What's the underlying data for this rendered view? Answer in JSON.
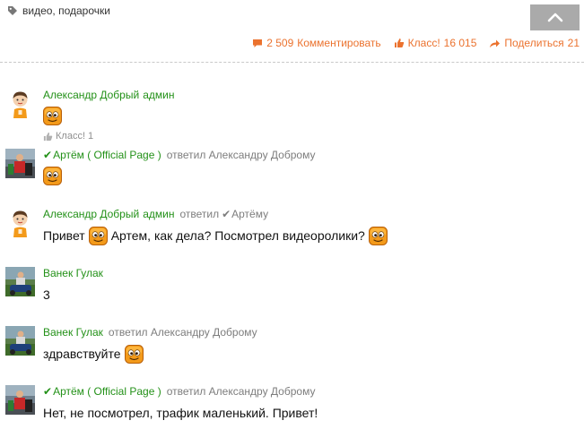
{
  "tags": {
    "text": "видео, подарочки"
  },
  "actions": {
    "comment_count": "2 509",
    "comment_label": "Комментировать",
    "like_label": "Класс!",
    "like_count": "16 015",
    "share_label": "Поделиться",
    "share_count": "21"
  },
  "colors": {
    "accent": "#eb722e",
    "author": "#239118",
    "muted": "#7d7d7d",
    "scroll_btn": "#aaaaaa"
  },
  "comments": [
    {
      "author": "Александр Добрый",
      "author_suffix": "админ",
      "verified": false,
      "reply_to": "",
      "reply_verified": false,
      "text": "",
      "smile_end": true,
      "likes": "Класс! 1",
      "avatar": "boy-cartoon"
    },
    {
      "author": "Артём ( Official Page )",
      "author_suffix": "",
      "verified": true,
      "reply_to": "ответил Александру Доброму",
      "reply_verified": false,
      "text": "",
      "smile_end": true,
      "likes": "",
      "avatar": "photo-red"
    },
    {
      "author": "Александр Добрый",
      "author_suffix": "админ",
      "verified": false,
      "reply_to_prefix": "ответил",
      "reply_to": "Артёму",
      "reply_verified": true,
      "text_part1": "Привет",
      "text_part2": "Артем, как дела? Посмотрел видеоролики?",
      "smile_end": true,
      "likes": "",
      "avatar": "boy-cartoon"
    },
    {
      "author": "Ванек Гулак",
      "author_suffix": "",
      "verified": false,
      "reply_to": "",
      "reply_verified": false,
      "text": "3",
      "smile_end": false,
      "likes": "",
      "avatar": "photo-green"
    },
    {
      "author": "Ванек Гулак",
      "author_suffix": "",
      "verified": false,
      "reply_to": "ответил Александру Доброму",
      "reply_verified": false,
      "text": "здравствуйте",
      "smile_end": true,
      "likes": "",
      "avatar": "photo-green"
    },
    {
      "author": "Артём ( Official Page )",
      "author_suffix": "",
      "verified": true,
      "reply_to": "ответил Александру Доброму",
      "reply_verified": false,
      "text": "Нет, не посмотрел, трафик маленький. Привет!",
      "smile_end": false,
      "likes": "",
      "avatar": "photo-red"
    }
  ]
}
